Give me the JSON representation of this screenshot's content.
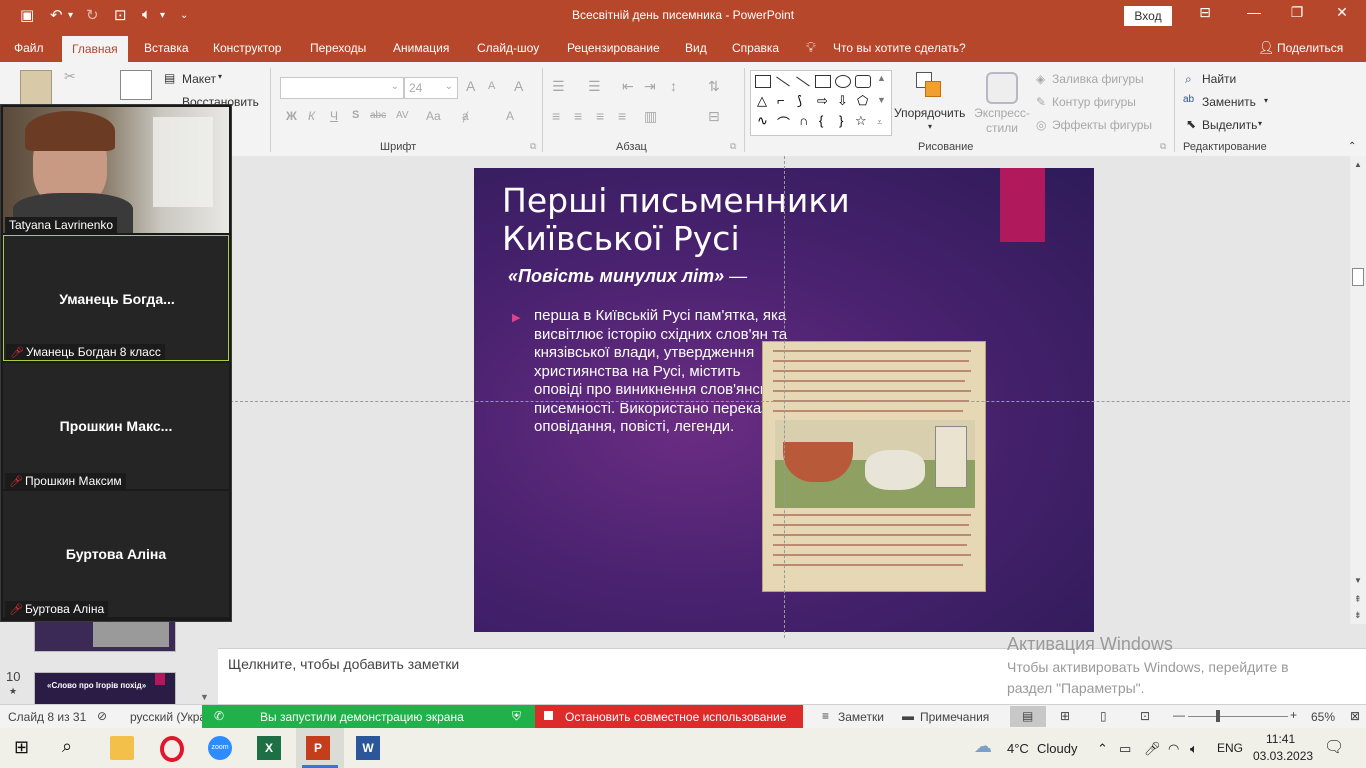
{
  "window": {
    "title": "Всесвітній день писемника - PowerPoint",
    "signin_label": "Вход"
  },
  "tabs": [
    "Файл",
    "Главная",
    "Вставка",
    "Конструктор",
    "Переходы",
    "Анимация",
    "Слайд-шоу",
    "Рецензирование",
    "Вид",
    "Справка"
  ],
  "tell_me": "Что вы хотите сделать?",
  "share_label": "Поделиться",
  "ribbon": {
    "slides": {
      "layout": "Макет",
      "reset": "Восстановить"
    },
    "font": {
      "size": "24",
      "label": "Шрифт",
      "bold": "Ж",
      "italic": "К",
      "underline": "Ч",
      "strike": "abc",
      "spacing": "AV",
      "case": "Aa",
      "color": "A"
    },
    "paragraph": {
      "label": "Абзац"
    },
    "drawing": {
      "arrange": "Упорядочить",
      "quick_styles": "Экспресс-стили",
      "fill": "Заливка фигуры",
      "outline": "Контур фигуры",
      "effects": "Эффекты фигуры",
      "label": "Рисование"
    },
    "editing": {
      "find": "Найти",
      "replace": "Заменить",
      "select": "Выделить",
      "label": "Редактирование"
    }
  },
  "slide": {
    "title": "Перші письменники Київської Русі",
    "subtitle": "«Повість минулих літ»",
    "subtitle_dash": " —",
    "bullet": "перша в Київській Русі пам'ятка, яка висвітлює історію східних слов'ян та князівської влади, утвердження християнства на Русі, містить оповіді про виникнення слов'янської писемності. Використано перекази, оповідання, повісті, легенди."
  },
  "notes_placeholder": "Щелкните, чтобы добавить заметки",
  "activation": {
    "title": "Активация Windows",
    "text": "Чтобы активировать Windows, перейдите в раздел \"Параметры\"."
  },
  "thumbnails": [
    {
      "number": "10",
      "star": "★",
      "title": "«Слово про Ігорів похід»"
    }
  ],
  "zoom": {
    "participants": [
      {
        "tag": "Tatyana Lavrinenko",
        "has_video": true
      },
      {
        "big": "Уманець  Богда...",
        "tag": "Уманець Богдан 8 класс",
        "muted": true,
        "highlighted": true
      },
      {
        "big": "Прошкин  Макс...",
        "tag": "Прошкин Максим",
        "muted": true
      },
      {
        "big": "Буртова Аліна",
        "tag": "Буртова Аліна",
        "muted": true
      }
    ],
    "share_notice": "Вы запустили демонстрацию экрана",
    "stop_share": "Остановить совместное использование"
  },
  "status": {
    "slide_counter": "Слайд 8 из 31",
    "language": "русский (Укра",
    "notes": "Заметки",
    "comments": "Примечания",
    "zoom": "65%"
  },
  "taskbar": {
    "weather_temp": "4°C",
    "weather_text": "Cloudy",
    "lang": "ENG",
    "time": "11:41",
    "date": "03.03.2023"
  },
  "colors": {
    "accent": "#b7472a",
    "slide_pink": "#b1195d",
    "share_green": "#21b14a",
    "share_red": "#dd2b2b"
  }
}
